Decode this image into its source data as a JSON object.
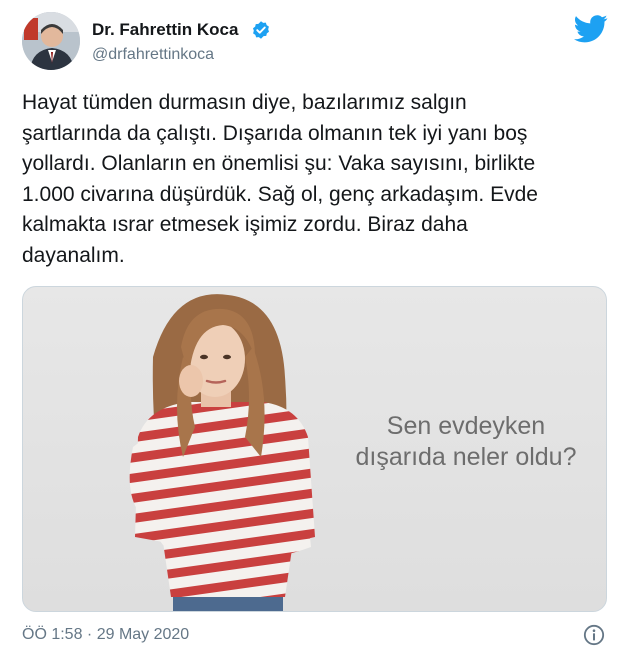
{
  "author": {
    "name": "Dr. Fahrettin Koca",
    "handle": "@drfahrettinkoca",
    "verified": true
  },
  "tweet": {
    "text": "Hayat tümden durmasın diye, bazılarımız salgın\nşartlarında da çalıştı. Dışarıda olmanın tek iyi yanı boş\nyollardı. Olanların en önemlisi şu: Vaka sayısını, birlikte\n1.000 civarına düşürdük. Sağ ol, genç arkadaşım. Evde\nkalmakta ısrar etmesek işimiz zordu. Biraz daha\ndayanalım.",
    "media": {
      "caption_line1": "Sen evdeyken",
      "caption_line2": "dışarıda neler oldu?"
    },
    "timestamp": "ÖÖ 1:58 · 29 May 2020"
  },
  "icons": {
    "verified": "verified-badge-icon",
    "brand": "twitter-bird-icon",
    "info": "info-icon"
  },
  "colors": {
    "brand_blue": "#1da1f2",
    "text": "#14171a",
    "muted": "#657786"
  }
}
